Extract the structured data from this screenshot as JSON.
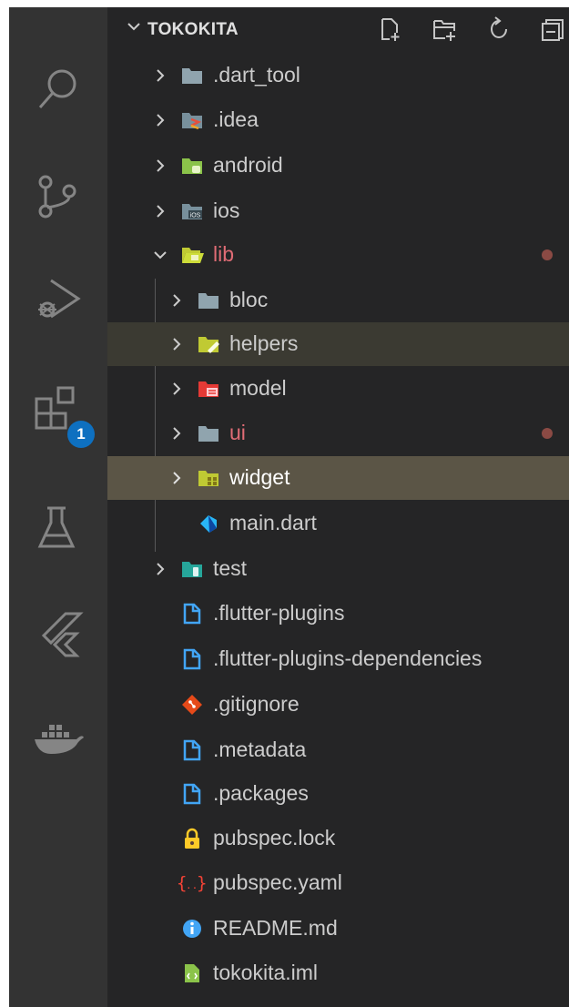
{
  "explorer": {
    "title": "TOKOKITA",
    "actions": [
      "new-file-icon",
      "new-folder-icon",
      "refresh-icon",
      "collapse-all-icon"
    ]
  },
  "activity_bar": {
    "items": [
      "search-icon",
      "source-control-icon",
      "run-debug-icon",
      "extensions-icon",
      "testing-icon",
      "flutter-icon",
      "docker-icon"
    ],
    "extensions_badge": "1"
  },
  "tree": {
    "dart_tool": ".dart_tool",
    "idea": ".idea",
    "android": "android",
    "ios": "ios",
    "lib": "lib",
    "bloc": "bloc",
    "helpers": "helpers",
    "model": "model",
    "ui": "ui",
    "widget": "widget",
    "main": "main.dart",
    "test": "test",
    "flutter_plugins": ".flutter-plugins",
    "flutter_plugins_deps": ".flutter-plugins-dependencies",
    "gitignore": ".gitignore",
    "metadata": ".metadata",
    "packages": ".packages",
    "pubspec_lock": "pubspec.lock",
    "pubspec_yaml": "pubspec.yaml",
    "readme": "README.md",
    "iml": "tokokita.iml"
  },
  "colors": {
    "modified_text": "#e06c75",
    "selection": "#5b5546",
    "badge": "#0e70c0"
  }
}
